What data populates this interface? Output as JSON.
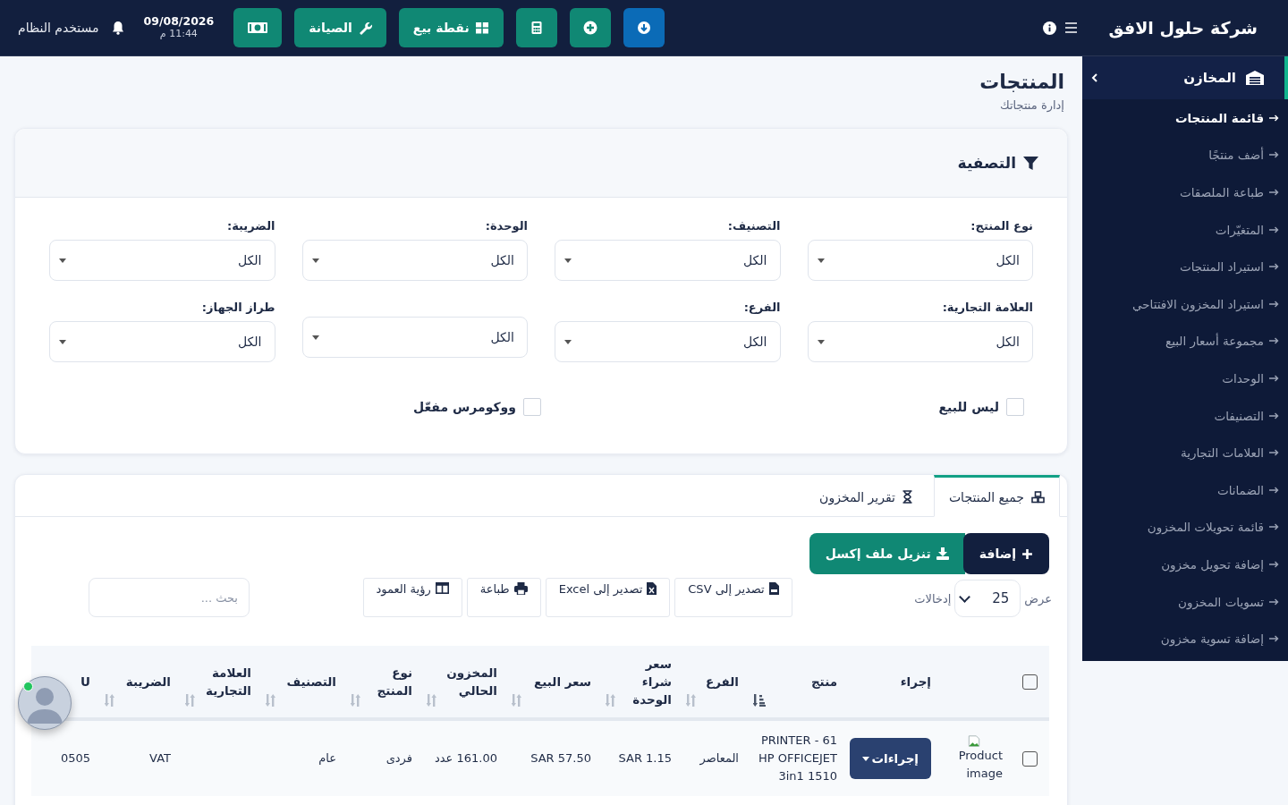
{
  "topbar": {
    "company": "شركة حلول الافق",
    "date": "09/08/2026",
    "time": "11:44 م",
    "user": "مستخدم النظام",
    "buttons": [
      {
        "kind": "download"
      },
      {
        "kind": "plus"
      },
      {
        "kind": "calculator"
      },
      {
        "kind": "pos",
        "label": "نقطة بيع"
      },
      {
        "kind": "wrench",
        "label": "الصيانة"
      },
      {
        "kind": "money"
      }
    ]
  },
  "sidebar": {
    "section": {
      "label": "المخازن",
      "expanded": true
    },
    "items": [
      {
        "label": "قائمة المنتجات",
        "selected": true
      },
      {
        "label": "أضف منتجًا",
        "selected": false
      },
      {
        "label": "طباعة الملصقات",
        "selected": false
      },
      {
        "label": "المتغيّرات",
        "selected": false
      },
      {
        "label": "استيراد المنتجات",
        "selected": false
      },
      {
        "label": "استيراد المخزون الافتتاحي",
        "selected": false
      },
      {
        "label": "مجموعة أسعار البيع",
        "selected": false
      },
      {
        "label": "الوحدات",
        "selected": false
      },
      {
        "label": "التصنيفات",
        "selected": false
      },
      {
        "label": "العلامات التجارية",
        "selected": false
      },
      {
        "label": "الضمانات",
        "selected": false
      },
      {
        "label": "قائمة تحويلات المخزون",
        "selected": false
      },
      {
        "label": "إضافة تحويل مخزون",
        "selected": false
      },
      {
        "label": "تسويات المخزون",
        "selected": false
      },
      {
        "label": "إضافة تسوية مخزون",
        "selected": false
      }
    ]
  },
  "page": {
    "title": "المنتجات",
    "subtitle": "إدارة منتجاتك"
  },
  "filters": {
    "title": "التصفية",
    "fields": [
      {
        "label": "نوع المنتج:",
        "value": "الكل"
      },
      {
        "label": "التصنيف:",
        "value": "الكل"
      },
      {
        "label": "الوحدة:",
        "value": "الكل"
      },
      {
        "label": "الضريبة:",
        "value": "الكل"
      },
      {
        "label": "العلامة التجارية:",
        "value": "الكل"
      },
      {
        "label": "الفرع:",
        "value": "الكل"
      },
      {
        "value": "الكل"
      },
      {
        "label": "طراز الجهاز:",
        "value": "الكل"
      }
    ],
    "checkboxes": [
      {
        "label": "ليس للبيع",
        "checked": false
      },
      {
        "label": "ووكومرس مفعّل",
        "checked": false
      }
    ]
  },
  "tabs": [
    {
      "label": "جميع المنتجات",
      "kind": "boxes",
      "selected": true
    },
    {
      "label": "تقرير المخزون",
      "kind": "hourglass",
      "selected": false
    }
  ],
  "actions": [
    {
      "label": "إضافة",
      "kind": "add"
    },
    {
      "label": "تنزيل ملف إكسل",
      "kind": "download"
    }
  ],
  "length": {
    "before": "عرض",
    "value": "25",
    "after": "إدخالات"
  },
  "exports": [
    {
      "label": "تصدير إلى CSV",
      "kind": "csv"
    },
    {
      "label": "تصدير إلى Excel",
      "kind": "excel"
    },
    {
      "label": "طباعة",
      "kind": "print"
    },
    {
      "label": "رؤية العمود",
      "kind": "columns"
    }
  ],
  "search": {
    "placeholder": "بحث ..."
  },
  "table": {
    "columns": [
      {
        "kind": "checkbox",
        "checked": false
      },
      {
        "kind": "blank"
      },
      {
        "label": "إجراء",
        "sortable": false
      },
      {
        "label": "منتج",
        "sortable": true,
        "sorted": true
      },
      {
        "label": "الفرع",
        "sortable": true,
        "sorted": false
      },
      {
        "label": "سعر شراء الوحدة",
        "sortable": true,
        "sorted": false
      },
      {
        "label": "سعر البيع",
        "sortable": true,
        "sorted": false
      },
      {
        "label": "المخزون الحالي",
        "sortable": true,
        "sorted": false
      },
      {
        "label": "نوع المنتج",
        "sortable": true,
        "sorted": false
      },
      {
        "label": "التصنيف",
        "sortable": true,
        "sorted": false
      },
      {
        "label": "العلامة التجارية",
        "sortable": true,
        "sorted": false
      },
      {
        "label": "الضريبة",
        "sortable": true,
        "sorted": false
      },
      {
        "label": "U"
      }
    ],
    "rows": [
      {
        "cells": [
          {
            "kind": "checkbox",
            "checked": false
          },
          {
            "kind": "image",
            "alt": "Product image"
          },
          {
            "kind": "button",
            "text": "إجراءات"
          },
          {
            "text": "PRINTER - 61 HP OFFICEJET 3in1 1510"
          },
          {
            "text": "المعاصر"
          },
          {
            "text": "SAR 1.15"
          },
          {
            "text": "SAR 57.50"
          },
          {
            "text": "161.00 عدد"
          },
          {
            "text": "فردى"
          },
          {
            "text": "عام"
          },
          {},
          {
            "text": "VAT"
          },
          {
            "text": "0505"
          }
        ]
      }
    ]
  },
  "avatar": {
    "online": true
  }
}
